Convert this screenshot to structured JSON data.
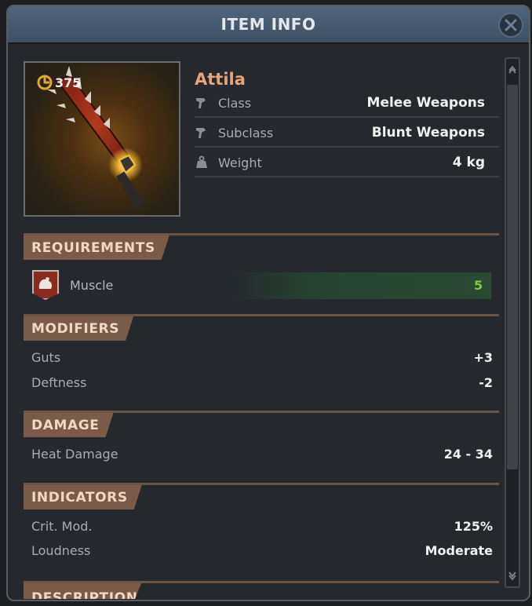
{
  "window": {
    "title": "ITEM INFO"
  },
  "item": {
    "name": "Attila",
    "level": "375",
    "stats": [
      {
        "icon": "weapon-icon",
        "label": "Class",
        "value": "Melee Weapons"
      },
      {
        "icon": "weapon-icon",
        "label": "Subclass",
        "value": "Blunt Weapons"
      },
      {
        "icon": "weight-icon",
        "label": "Weight",
        "value": "4 kg"
      }
    ]
  },
  "requirements": {
    "header": "REQUIREMENTS",
    "label": "Muscle",
    "value": "5",
    "value_color": "#7ccd3a"
  },
  "modifiers": {
    "header": "MODIFIERS",
    "rows": [
      {
        "label": "Guts",
        "value": "+3"
      },
      {
        "label": "Deftness",
        "value": "-2"
      }
    ]
  },
  "damage": {
    "header": "DAMAGE",
    "rows": [
      {
        "label": "Heat Damage",
        "value": "24 - 34"
      }
    ]
  },
  "indicators": {
    "header": "INDICATORS",
    "rows": [
      {
        "label": "Crit. Mod.",
        "value": "125%"
      },
      {
        "label": "Loudness",
        "value": "Moderate"
      }
    ]
  },
  "description": {
    "header": "DESCRIPTION"
  },
  "colors": {
    "accent_name": "#e6a47c",
    "section_tab": "#7a5b49",
    "titlebar": "#52657c"
  }
}
